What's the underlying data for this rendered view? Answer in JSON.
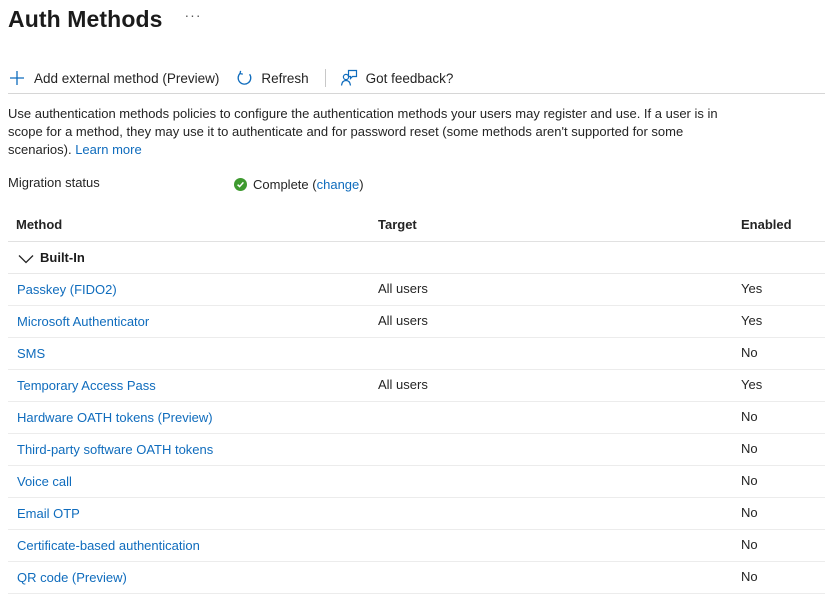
{
  "header": {
    "title": "Auth Methods",
    "more_icon": "ellipsis-icon",
    "more_label": "···"
  },
  "toolbar": {
    "add_label": "Add external method (Preview)",
    "refresh_label": "Refresh",
    "feedback_label": "Got feedback?"
  },
  "description": {
    "text": "Use authentication methods policies to configure the authentication methods your users may register and use. If a user is in scope for a method, they may use it to authenticate and for password reset (some methods aren't supported for some scenarios).",
    "learn_more": "Learn more"
  },
  "migration": {
    "label": "Migration status",
    "status": "Complete",
    "open_paren": "(",
    "change_link": "change",
    "close_paren": ")",
    "status_color": "#3e9a2f"
  },
  "table": {
    "headers": {
      "method": "Method",
      "target": "Target",
      "enabled": "Enabled"
    },
    "group_label": "Built-In",
    "rows": [
      {
        "method": "Passkey (FIDO2)",
        "target": "All users",
        "enabled": "Yes"
      },
      {
        "method": "Microsoft Authenticator",
        "target": "All users",
        "enabled": "Yes"
      },
      {
        "method": "SMS",
        "target": "",
        "enabled": "No"
      },
      {
        "method": "Temporary Access Pass",
        "target": "All users",
        "enabled": "Yes"
      },
      {
        "method": "Hardware OATH tokens (Preview)",
        "target": "",
        "enabled": "No"
      },
      {
        "method": "Third-party software OATH tokens",
        "target": "",
        "enabled": "No"
      },
      {
        "method": "Voice call",
        "target": "",
        "enabled": "No"
      },
      {
        "method": "Email OTP",
        "target": "",
        "enabled": "No"
      },
      {
        "method": "Certificate-based authentication",
        "target": "",
        "enabled": "No"
      },
      {
        "method": "QR code (Preview)",
        "target": "",
        "enabled": "No"
      }
    ]
  },
  "colors": {
    "link": "#0f6cbd",
    "accent": "#0f6cbd"
  }
}
